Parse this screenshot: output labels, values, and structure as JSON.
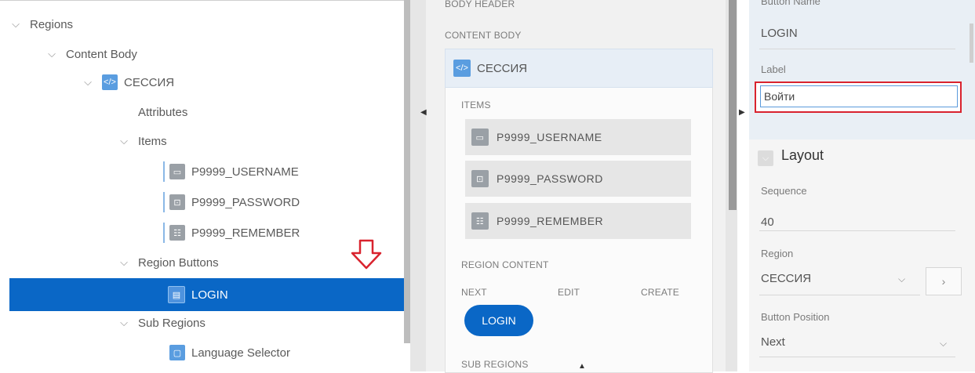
{
  "tree": {
    "regions": "Regions",
    "content_body": "Content Body",
    "session": "СЕССИЯ",
    "attributes": "Attributes",
    "items": "Items",
    "item_username": "P9999_USERNAME",
    "item_password": "P9999_PASSWORD",
    "item_remember": "P9999_REMEMBER",
    "region_buttons": "Region Buttons",
    "login": "LOGIN",
    "sub_regions": "Sub Regions",
    "language_selector": "Language Selector"
  },
  "layout_panel": {
    "body_header": "BODY HEADER",
    "content_body": "CONTENT BODY",
    "region_title": "СЕССИЯ",
    "items_caption": "ITEMS",
    "items": [
      "P9999_USERNAME",
      "P9999_PASSWORD",
      "P9999_REMEMBER"
    ],
    "region_content": "REGION CONTENT",
    "positions": [
      "NEXT",
      "EDIT",
      "CREATE"
    ],
    "login_button": "LOGIN",
    "sub_regions": "SUB REGIONS"
  },
  "properties": {
    "button_name_label": "Button Name",
    "button_name_value": "LOGIN",
    "label_label": "Label",
    "label_value": "Войти",
    "layout_section": "Layout",
    "sequence_label": "Sequence",
    "sequence_value": "40",
    "region_label": "Region",
    "region_value": "СЕССИЯ",
    "button_position_label": "Button Position",
    "button_position_value": "Next"
  },
  "colors": {
    "selection": "#0a67c6",
    "highlight_border": "#d9232e"
  }
}
